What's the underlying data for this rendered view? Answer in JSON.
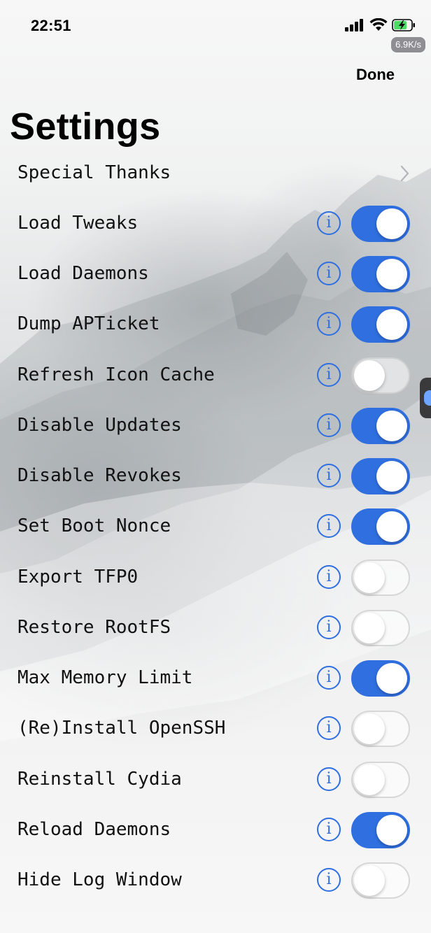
{
  "status_bar": {
    "time": "22:51",
    "network_speed": "6.9K/s",
    "icons": [
      "signal-icon",
      "wifi-icon",
      "battery-charging-icon"
    ]
  },
  "nav": {
    "done_label": "Done",
    "title": "Settings"
  },
  "colors": {
    "accent": "#2f6fe0",
    "toggle_off_border": "#c8c8c8"
  },
  "rows": [
    {
      "label": "Special Thanks",
      "type": "link"
    },
    {
      "label": "Load Tweaks",
      "type": "toggle",
      "on": true
    },
    {
      "label": "Load Daemons",
      "type": "toggle",
      "on": true
    },
    {
      "label": "Dump APTicket",
      "type": "toggle",
      "on": true
    },
    {
      "label": "Refresh Icon Cache",
      "type": "toggle",
      "on": false
    },
    {
      "label": "Disable Updates",
      "type": "toggle",
      "on": true
    },
    {
      "label": "Disable Revokes",
      "type": "toggle",
      "on": true
    },
    {
      "label": "Set Boot Nonce",
      "type": "toggle",
      "on": true
    },
    {
      "label": "Export TFP0",
      "type": "toggle",
      "on": false
    },
    {
      "label": "Restore RootFS",
      "type": "toggle",
      "on": false
    },
    {
      "label": "Max Memory Limit",
      "type": "toggle",
      "on": true
    },
    {
      "label": "(Re)Install OpenSSH",
      "type": "toggle",
      "on": false
    },
    {
      "label": "Reinstall Cydia",
      "type": "toggle",
      "on": false
    },
    {
      "label": "Reload Daemons",
      "type": "toggle",
      "on": true
    },
    {
      "label": "Hide Log Window",
      "type": "toggle",
      "on": false
    }
  ],
  "info_glyph": "i"
}
